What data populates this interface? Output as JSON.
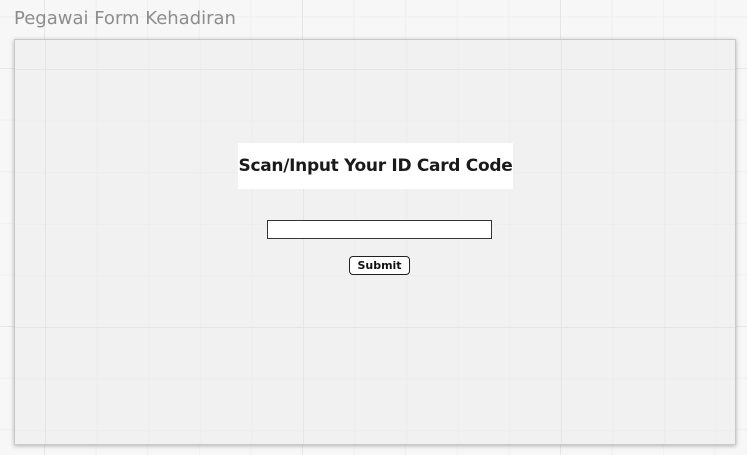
{
  "page": {
    "title": "Pegawai Form Kehadiran"
  },
  "form": {
    "heading": "Scan/Input Your ID Card Code",
    "input_value": "",
    "input_placeholder": "",
    "submit_label": "Submit"
  },
  "colors": {
    "background": "#f7f7f7",
    "frame_background": "#f1f1f1",
    "title_text": "#8d8d8d",
    "heading_text": "#1a1a1a"
  }
}
